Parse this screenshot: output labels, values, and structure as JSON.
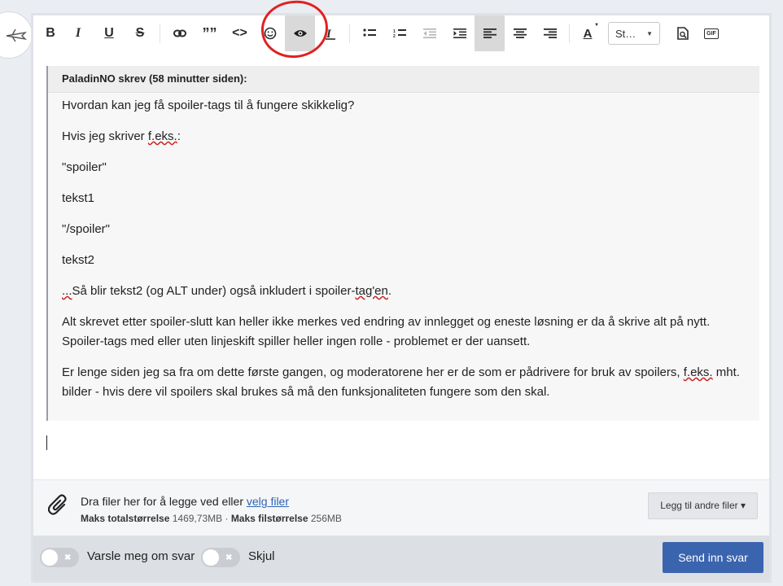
{
  "toolbar": {
    "bold": "B",
    "italic": "I",
    "underline": "U",
    "strike": "S",
    "quote_glyph": "””",
    "code_glyph": "<>",
    "style_select": "St…",
    "gif_label": "GIF",
    "font_color_letter": "A"
  },
  "quote": {
    "header": "PaladinNO skrev (58 minutter siden):",
    "p1": "Hvordan kan jeg få spoiler-tags til å fungere skikkelig?",
    "p2_pre": "Hvis jeg skriver ",
    "p2_mark": "f.eks.",
    "p2_post": ":",
    "p3": "\"spoiler\"",
    "p4": "tekst1",
    "p5": "\"/spoiler\"",
    "p6": "tekst2",
    "p7_mark": "...",
    "p7_mid": "Så blir tekst2 (og ALT under) også inkludert i spoiler-",
    "p7_mark2": "tag'en",
    "p7_post": ".",
    "p8": "Alt skrevet etter spoiler-slutt kan heller ikke merkes ved endring av innlegget og eneste løsning er da å skrive alt på nytt. Spoiler-tags med eller uten linjeskift spiller heller ingen rolle - problemet er der uansett.",
    "p9_pre": "Er lenge siden jeg sa fra om dette første gangen, og moderatorene her er de som er pådrivere for bruk av spoilers, ",
    "p9_mark": "f.eks.",
    "p9_post": " mht. bilder - hvis dere vil spoilers skal brukes så må den funksjonaliteten fungere som den skal."
  },
  "attach": {
    "text": "Dra filer her for å legge ved eller ",
    "link": "velg filer",
    "total_label": "Maks totalstørrelse",
    "total_value": "1469,73MB",
    "dot": "·",
    "file_label": "Maks filstørrelse",
    "file_value": "256MB",
    "other_button": "Legg til andre filer ▾"
  },
  "footer": {
    "notify_label": "Varsle meg om svar",
    "hide_label": "Skjul",
    "toggle_off": "✖",
    "send_button": "Send inn svar"
  }
}
